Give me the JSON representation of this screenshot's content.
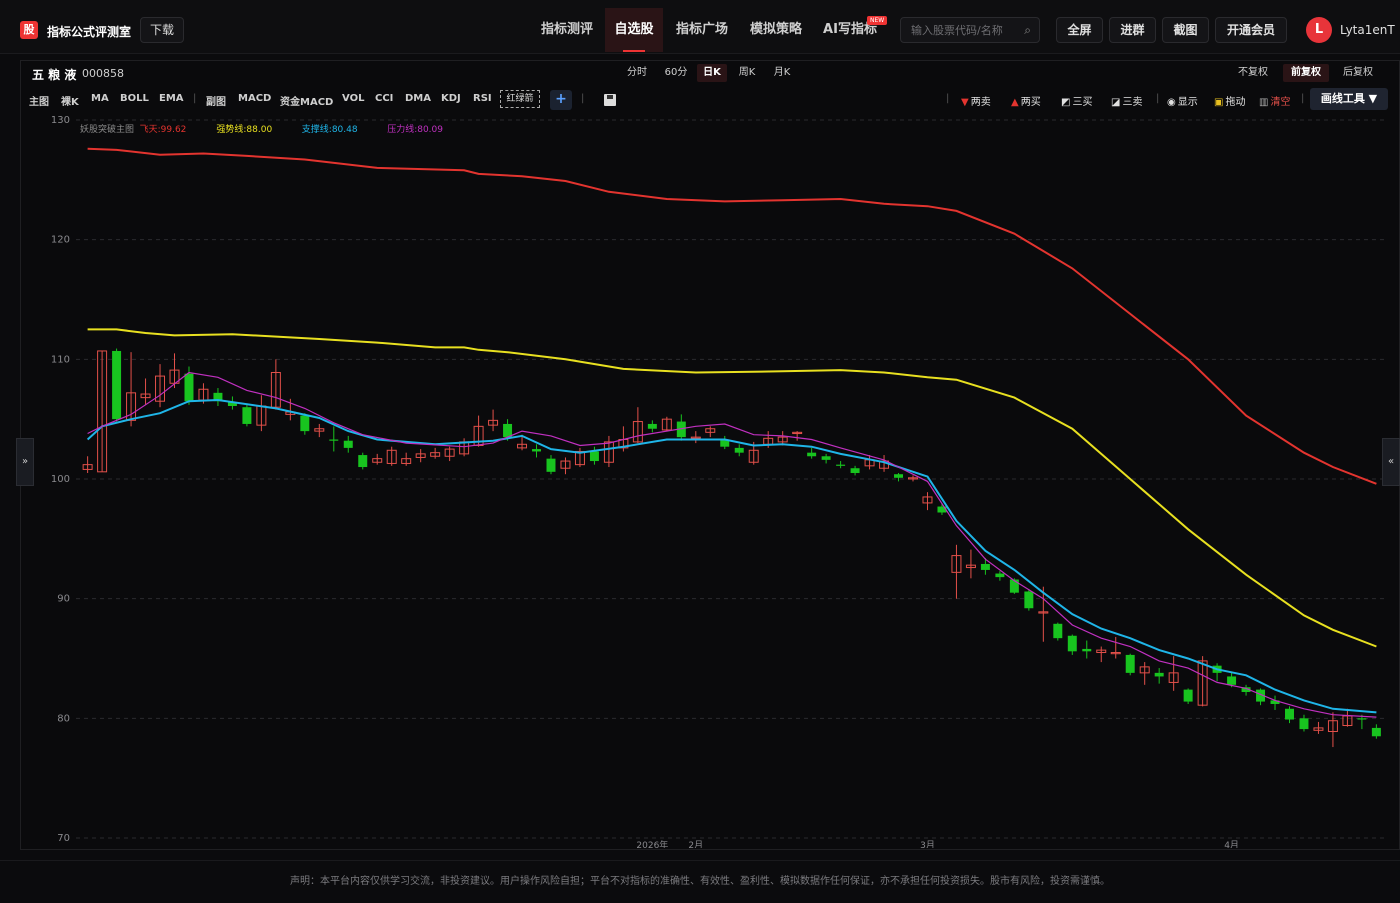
{
  "header": {
    "logo_glyph": "股",
    "site_title": "指标公式评测室",
    "download_label": "下载",
    "nav": [
      {
        "label": "指标测评",
        "active": false
      },
      {
        "label": "自选股",
        "active": true
      },
      {
        "label": "指标广场",
        "active": false
      },
      {
        "label": "模拟策略",
        "active": false
      },
      {
        "label": "AI写指标",
        "active": false
      }
    ],
    "new_badge": "NEW",
    "search_placeholder": "输入股票代码/名称",
    "buttons": [
      "全屏",
      "进群",
      "截图",
      "开通会员"
    ],
    "avatar_letter": "L",
    "username": "Lyta1enT"
  },
  "stock": {
    "name": "五 粮 液",
    "code": "000858"
  },
  "periods": [
    {
      "label": "分时",
      "active": false
    },
    {
      "label": "60分",
      "active": false
    },
    {
      "label": "日K",
      "active": true
    },
    {
      "label": "周K",
      "active": false
    },
    {
      "label": "月K",
      "active": false
    }
  ],
  "adjust": [
    {
      "label": "不复权",
      "active": false
    },
    {
      "label": "前复权",
      "active": true
    },
    {
      "label": "后复权",
      "active": false
    }
  ],
  "indicators": {
    "main_label": "主图",
    "main": [
      "裸K",
      "MA",
      "BOLL",
      "EMA"
    ],
    "sub_label": "副图",
    "sub": [
      "MACD",
      "资金MACD",
      "VOL",
      "CCI",
      "DMA",
      "KDJ",
      "RSI"
    ],
    "dashed_item": "红绿箭",
    "plus": "+"
  },
  "tools": {
    "sell2": "两卖",
    "buy2": "两买",
    "buy3": "三买",
    "sell3": "三卖",
    "show": "显示",
    "drag": "拖动",
    "clear": "清空",
    "draw_tools": "画线工具 ▼"
  },
  "side_tabs": {
    "left": "»",
    "right": "«"
  },
  "chart_data": {
    "type": "candlestick",
    "legend": [
      {
        "label": "妖股突破主图",
        "color": "#8a8a8a"
      },
      {
        "label": "飞天:99.62",
        "color": "#e3342f"
      },
      {
        "label": "强势线:88.00",
        "color": "#e8e020"
      },
      {
        "label": "支撑线:80.48",
        "color": "#1fb5e8"
      },
      {
        "label": "压力线:80.09",
        "color": "#c030c0"
      }
    ],
    "ylim": [
      70,
      130
    ],
    "yticks": [
      130,
      120,
      110,
      100,
      90,
      80,
      70
    ],
    "xticks": [
      {
        "i": 39,
        "label": "2026年"
      },
      {
        "i": 42,
        "label": "2月"
      },
      {
        "i": 58,
        "label": "3月"
      },
      {
        "i": 79,
        "label": "4月"
      }
    ],
    "candles": [
      [
        100.8,
        101.2,
        100.5,
        101.9
      ],
      [
        100.6,
        110.7,
        100.6,
        110.7
      ],
      [
        110.7,
        105.0,
        104.8,
        110.9
      ],
      [
        104.9,
        107.2,
        104.4,
        110.6
      ],
      [
        106.8,
        107.1,
        106.2,
        108.4
      ],
      [
        106.5,
        108.6,
        106.0,
        109.6
      ],
      [
        108.0,
        109.1,
        107.6,
        110.5
      ],
      [
        108.8,
        106.5,
        106.2,
        109.4
      ],
      [
        106.6,
        107.5,
        106.3,
        108.0
      ],
      [
        107.2,
        106.5,
        106.1,
        107.6
      ],
      [
        106.4,
        106.1,
        105.8,
        106.9
      ],
      [
        106.0,
        104.6,
        104.4,
        106.2
      ],
      [
        104.5,
        106.1,
        104.0,
        107.0
      ],
      [
        106.0,
        108.9,
        105.8,
        110.0
      ],
      [
        105.4,
        105.6,
        104.9,
        106.7
      ],
      [
        105.3,
        104.0,
        103.7,
        105.5
      ],
      [
        104.0,
        104.2,
        103.5,
        104.6
      ],
      [
        103.3,
        103.2,
        102.3,
        104.4
      ],
      [
        103.2,
        102.6,
        102.2,
        103.6
      ],
      [
        102.0,
        101.0,
        100.8,
        102.2
      ],
      [
        101.4,
        101.7,
        101.2,
        102.1
      ],
      [
        101.3,
        102.4,
        101.1,
        102.7
      ],
      [
        101.3,
        101.7,
        101.1,
        102.2
      ],
      [
        101.8,
        102.1,
        101.4,
        102.5
      ],
      [
        101.9,
        102.2,
        101.7,
        102.6
      ],
      [
        101.9,
        102.5,
        101.5,
        102.7
      ],
      [
        102.1,
        103.1,
        101.9,
        103.4
      ],
      [
        102.8,
        104.4,
        102.7,
        105.3
      ],
      [
        104.5,
        104.9,
        104.0,
        105.8
      ],
      [
        104.6,
        103.5,
        103.2,
        105.0
      ],
      [
        102.6,
        102.9,
        102.4,
        103.7
      ],
      [
        102.5,
        102.3,
        101.8,
        102.9
      ],
      [
        101.7,
        100.6,
        100.4,
        102.0
      ],
      [
        100.9,
        101.5,
        100.4,
        101.8
      ],
      [
        101.2,
        102.3,
        101.0,
        102.6
      ],
      [
        102.3,
        101.5,
        101.2,
        102.7
      ],
      [
        101.4,
        103.1,
        101.0,
        103.6
      ],
      [
        102.6,
        103.3,
        102.3,
        104.4
      ],
      [
        103.1,
        104.8,
        103.0,
        106.0
      ],
      [
        104.6,
        104.2,
        103.9,
        104.9
      ],
      [
        104.1,
        105.0,
        104.0,
        105.2
      ],
      [
        104.8,
        103.5,
        103.2,
        105.4
      ],
      [
        103.5,
        103.5,
        103.0,
        104.0
      ],
      [
        103.9,
        104.2,
        103.5,
        104.4
      ],
      [
        103.3,
        102.7,
        102.5,
        103.6
      ],
      [
        102.6,
        102.2,
        101.9,
        102.9
      ],
      [
        101.4,
        102.4,
        101.2,
        103.1
      ],
      [
        102.9,
        103.4,
        102.6,
        104.0
      ],
      [
        103.1,
        103.5,
        102.8,
        104.0
      ],
      [
        103.8,
        103.9,
        103.2,
        104.0
      ],
      [
        102.2,
        101.9,
        101.7,
        102.6
      ],
      [
        101.9,
        101.6,
        101.3,
        102.1
      ],
      [
        101.2,
        101.1,
        100.9,
        101.5
      ],
      [
        100.9,
        100.5,
        100.3,
        101.1
      ],
      [
        101.1,
        101.6,
        100.8,
        102.0
      ],
      [
        100.9,
        101.5,
        100.6,
        102.0
      ],
      [
        100.4,
        100.1,
        99.8,
        100.5
      ],
      [
        100.0,
        100.1,
        99.8,
        100.3
      ],
      [
        98.0,
        98.5,
        97.4,
        98.9
      ],
      [
        97.7,
        97.2,
        97.0,
        98.0
      ],
      [
        92.2,
        93.6,
        90.0,
        94.5
      ],
      [
        92.6,
        92.8,
        91.7,
        94.1
      ],
      [
        92.9,
        92.4,
        92.0,
        93.4
      ],
      [
        92.1,
        91.8,
        91.5,
        92.3
      ],
      [
        91.6,
        90.5,
        90.4,
        91.7
      ],
      [
        90.6,
        89.2,
        89.0,
        90.8
      ],
      [
        88.8,
        88.9,
        86.4,
        91.0
      ],
      [
        87.9,
        86.7,
        86.5,
        88.0
      ],
      [
        86.9,
        85.6,
        85.3,
        87.0
      ],
      [
        85.8,
        85.6,
        85.0,
        86.5
      ],
      [
        85.5,
        85.7,
        84.7,
        86.0
      ],
      [
        85.4,
        85.5,
        85.0,
        86.8
      ],
      [
        85.3,
        83.8,
        83.6,
        85.4
      ],
      [
        83.8,
        84.3,
        82.8,
        84.7
      ],
      [
        83.8,
        83.5,
        82.9,
        84.2
      ],
      [
        83.0,
        83.8,
        82.3,
        85.2
      ],
      [
        82.4,
        81.4,
        81.2,
        82.5
      ],
      [
        81.1,
        84.8,
        81.0,
        85.2
      ],
      [
        84.4,
        83.8,
        83.1,
        84.6
      ],
      [
        83.5,
        82.8,
        82.6,
        83.8
      ],
      [
        82.6,
        82.2,
        81.9,
        82.8
      ],
      [
        82.4,
        81.4,
        81.1,
        82.5
      ],
      [
        81.5,
        81.2,
        80.7,
        81.9
      ],
      [
        80.8,
        79.9,
        79.6,
        81.0
      ],
      [
        80.0,
        79.1,
        78.9,
        80.3
      ],
      [
        79.0,
        79.2,
        78.7,
        79.7
      ],
      [
        78.9,
        79.8,
        77.6,
        80.5
      ],
      [
        79.4,
        80.2,
        79.3,
        80.8
      ],
      [
        80.0,
        79.9,
        79.1,
        80.3
      ],
      [
        79.2,
        78.5,
        78.3,
        79.5
      ]
    ],
    "series": [
      {
        "name": "飞天",
        "color": "#e3342f",
        "points": [
          [
            0,
            127.6
          ],
          [
            2,
            127.5
          ],
          [
            5,
            127.1
          ],
          [
            8,
            127.2
          ],
          [
            11,
            127.0
          ],
          [
            15,
            126.7
          ],
          [
            20,
            126.0
          ],
          [
            26,
            125.8
          ],
          [
            27,
            125.5
          ],
          [
            30,
            125.3
          ],
          [
            33,
            124.9
          ],
          [
            36,
            124.0
          ],
          [
            40,
            123.4
          ],
          [
            44,
            123.2
          ],
          [
            48,
            123.3
          ],
          [
            52,
            123.4
          ],
          [
            55,
            123.0
          ],
          [
            58,
            122.8
          ],
          [
            60,
            122.4
          ],
          [
            64,
            120.5
          ],
          [
            68,
            117.6
          ],
          [
            72,
            113.8
          ],
          [
            76,
            110.0
          ],
          [
            80,
            105.3
          ],
          [
            84,
            102.2
          ],
          [
            86,
            101.0
          ],
          [
            89,
            99.6
          ]
        ]
      },
      {
        "name": "强势线",
        "color": "#e8e020",
        "points": [
          [
            0,
            112.5
          ],
          [
            2,
            112.5
          ],
          [
            4,
            112.2
          ],
          [
            6,
            112.0
          ],
          [
            10,
            112.1
          ],
          [
            16,
            111.7
          ],
          [
            20,
            111.4
          ],
          [
            24,
            111.0
          ],
          [
            26,
            111.0
          ],
          [
            27,
            110.8
          ],
          [
            29,
            110.6
          ],
          [
            33,
            110.0
          ],
          [
            37,
            109.2
          ],
          [
            42,
            108.9
          ],
          [
            48,
            109.0
          ],
          [
            52,
            109.1
          ],
          [
            55,
            108.9
          ],
          [
            58,
            108.5
          ],
          [
            60,
            108.3
          ],
          [
            64,
            106.8
          ],
          [
            68,
            104.2
          ],
          [
            72,
            100.0
          ],
          [
            76,
            95.8
          ],
          [
            80,
            92.0
          ],
          [
            84,
            88.6
          ],
          [
            86,
            87.4
          ],
          [
            89,
            86.0
          ]
        ]
      },
      {
        "name": "支撑线",
        "color": "#1fb5e8",
        "points": [
          [
            0,
            103.3
          ],
          [
            1,
            104.4
          ],
          [
            3,
            105.0
          ],
          [
            5,
            105.5
          ],
          [
            7,
            106.5
          ],
          [
            9,
            106.6
          ],
          [
            13,
            105.9
          ],
          [
            16,
            105.1
          ],
          [
            18,
            104.0
          ],
          [
            20,
            103.3
          ],
          [
            24,
            102.9
          ],
          [
            28,
            103.2
          ],
          [
            30,
            103.6
          ],
          [
            32,
            102.5
          ],
          [
            34,
            102.2
          ],
          [
            37,
            102.7
          ],
          [
            40,
            103.3
          ],
          [
            44,
            103.3
          ],
          [
            46,
            102.8
          ],
          [
            48,
            102.9
          ],
          [
            50,
            102.7
          ],
          [
            52,
            102.1
          ],
          [
            55,
            101.4
          ],
          [
            58,
            100.2
          ],
          [
            60,
            96.5
          ],
          [
            62,
            94.0
          ],
          [
            64,
            92.4
          ],
          [
            66,
            90.5
          ],
          [
            68,
            88.7
          ],
          [
            70,
            87.5
          ],
          [
            72,
            86.7
          ],
          [
            74,
            85.7
          ],
          [
            76,
            85.0
          ],
          [
            78,
            84.1
          ],
          [
            80,
            83.6
          ],
          [
            82,
            82.4
          ],
          [
            84,
            81.5
          ],
          [
            86,
            80.8
          ],
          [
            89,
            80.5
          ]
        ]
      },
      {
        "name": "压力线",
        "color": "#c030c0",
        "points": [
          [
            0,
            103.8
          ],
          [
            1,
            104.4
          ],
          [
            3,
            105.4
          ],
          [
            5,
            107.0
          ],
          [
            7,
            108.9
          ],
          [
            9,
            108.5
          ],
          [
            11,
            107.4
          ],
          [
            13,
            106.8
          ],
          [
            15,
            105.9
          ],
          [
            17,
            104.7
          ],
          [
            19,
            103.7
          ],
          [
            22,
            103.0
          ],
          [
            26,
            102.7
          ],
          [
            28,
            103.0
          ],
          [
            30,
            104.0
          ],
          [
            32,
            103.6
          ],
          [
            34,
            102.8
          ],
          [
            36,
            103.0
          ],
          [
            38,
            103.6
          ],
          [
            42,
            104.4
          ],
          [
            44,
            104.6
          ],
          [
            46,
            103.7
          ],
          [
            48,
            103.6
          ],
          [
            50,
            103.3
          ],
          [
            52,
            102.6
          ],
          [
            55,
            101.6
          ],
          [
            58,
            99.8
          ],
          [
            60,
            96.1
          ],
          [
            62,
            93.3
          ],
          [
            64,
            91.5
          ],
          [
            66,
            90.0
          ],
          [
            68,
            87.8
          ],
          [
            70,
            86.7
          ],
          [
            72,
            86.0
          ],
          [
            74,
            84.8
          ],
          [
            76,
            84.2
          ],
          [
            78,
            83.0
          ],
          [
            80,
            82.5
          ],
          [
            82,
            81.5
          ],
          [
            84,
            80.8
          ],
          [
            86,
            80.3
          ],
          [
            89,
            80.1
          ]
        ]
      }
    ],
    "up_color": "#e3504a",
    "down_color": "#18c41f"
  },
  "footer": "声明：本平台内容仅供学习交流，非投资建议。用户操作风险自担；平台不对指标的准确性、有效性、盈利性、模拟数据作任何保证，亦不承担任何投资损失。股市有风险，投资需谨慎。"
}
